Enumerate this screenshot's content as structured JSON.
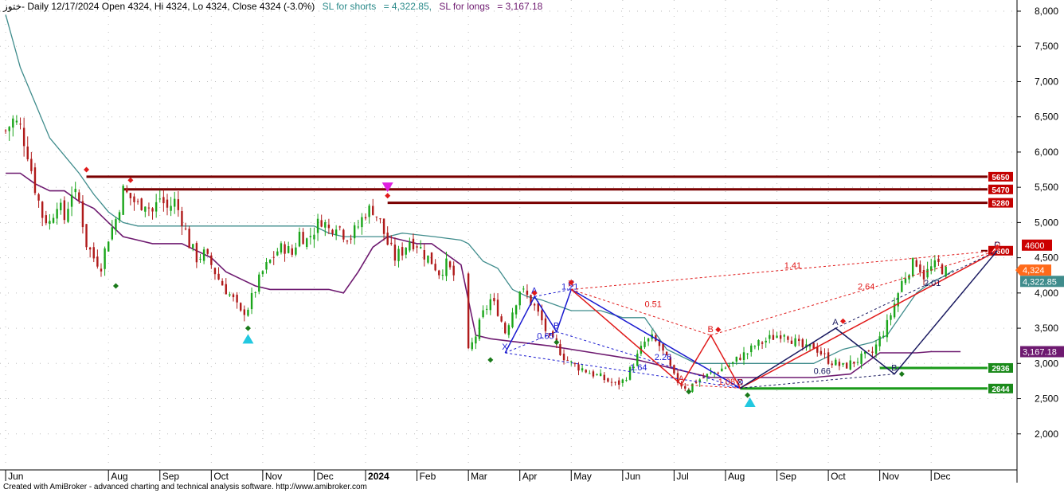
{
  "header": {
    "symbol": "ختوز",
    "title": "- Daily 12/17/2024 Open 4324, Hi 4324, Lo 4324, Close 4324 (-3.0%)",
    "sl_shorts_label": "SL for shorts",
    "sl_shorts_value": "= 4,322.85,",
    "sl_longs_label": "SL for longs",
    "sl_longs_value": "= 3,167.18"
  },
  "footer": "Created with AmiBroker - advanced charting and technical analysis software. http://www.amibroker.com",
  "colors": {
    "resistance": "#7a0000",
    "support": "#1a9a1a",
    "candle_up": "#1aa51a",
    "candle_down": "#b01a1a",
    "stop_shorts": "#3f8c8c",
    "stop_longs": "#6e1a70",
    "harmonic_red": "#e01a1a",
    "harmonic_blue": "#1a1ad0",
    "harmonic_dark": "#1a1a60",
    "marker_cyan": "#22c8e0",
    "marker_magenta": "#e020e0"
  },
  "chart_data": {
    "type": "candlestick",
    "ylim": [
      1600,
      8200
    ],
    "y_ticks": [
      2000,
      2500,
      3000,
      3500,
      4000,
      4500,
      5000,
      5500,
      6000,
      6500,
      7000,
      7500,
      8000
    ],
    "y_tick_labels": [
      "2,000",
      "2,500",
      "3,000",
      "3,500",
      "4,000",
      "4,500",
      "5,000",
      "5,500",
      "6,000",
      "6,500",
      "7,000",
      "7,500",
      "8,000"
    ],
    "x_ticks": [
      {
        "label": "Jun",
        "x": 0,
        "bold": false
      },
      {
        "label": "Aug",
        "x": 42,
        "bold": false
      },
      {
        "label": "Sep",
        "x": 63,
        "bold": false
      },
      {
        "label": "Oct",
        "x": 84,
        "bold": false
      },
      {
        "label": "Nov",
        "x": 105,
        "bold": false
      },
      {
        "label": "Dec",
        "x": 126,
        "bold": false
      },
      {
        "label": "2024",
        "x": 147,
        "bold": true
      },
      {
        "label": "Feb",
        "x": 168,
        "bold": false
      },
      {
        "label": "Mar",
        "x": 189,
        "bold": false
      },
      {
        "label": "Apr",
        "x": 210,
        "bold": false
      },
      {
        "label": "May",
        "x": 231,
        "bold": false
      },
      {
        "label": "Jun",
        "x": 252,
        "bold": false
      },
      {
        "label": "Jul",
        "x": 273,
        "bold": false
      },
      {
        "label": "Aug",
        "x": 294,
        "bold": false
      },
      {
        "label": "Sep",
        "x": 315,
        "bold": false
      },
      {
        "label": "Oct",
        "x": 336,
        "bold": false
      },
      {
        "label": "Nov",
        "x": 357,
        "bold": false
      },
      {
        "label": "Dec",
        "x": 378,
        "bold": false
      }
    ],
    "x_range": [
      -1,
      402
    ],
    "close_path": [
      [
        0,
        6300
      ],
      [
        3,
        6450
      ],
      [
        6,
        6350
      ],
      [
        9,
        6000
      ],
      [
        12,
        5500
      ],
      [
        15,
        5100
      ],
      [
        18,
        5000
      ],
      [
        21,
        5300
      ],
      [
        24,
        5050
      ],
      [
        27,
        5450
      ],
      [
        30,
        5300
      ],
      [
        33,
        4700
      ],
      [
        36,
        4500
      ],
      [
        39,
        4400
      ],
      [
        42,
        4800
      ],
      [
        45,
        5050
      ],
      [
        48,
        5450
      ],
      [
        51,
        5350
      ],
      [
        54,
        5250
      ],
      [
        57,
        5300
      ],
      [
        60,
        5150
      ],
      [
        63,
        5350
      ],
      [
        66,
        5200
      ],
      [
        69,
        5300
      ],
      [
        72,
        5050
      ],
      [
        75,
        4700
      ],
      [
        78,
        4500
      ],
      [
        81,
        4550
      ],
      [
        84,
        4400
      ],
      [
        87,
        4200
      ],
      [
        90,
        4050
      ],
      [
        93,
        3900
      ],
      [
        96,
        3700
      ],
      [
        99,
        3800
      ],
      [
        102,
        4050
      ],
      [
        105,
        4300
      ],
      [
        108,
        4450
      ],
      [
        111,
        4600
      ],
      [
        114,
        4650
      ],
      [
        117,
        4550
      ],
      [
        120,
        4850
      ],
      [
        123,
        4750
      ],
      [
        126,
        4900
      ],
      [
        129,
        5050
      ],
      [
        132,
        4900
      ],
      [
        135,
        5000
      ],
      [
        138,
        4850
      ],
      [
        141,
        4800
      ],
      [
        144,
        4950
      ],
      [
        147,
        5150
      ],
      [
        150,
        5200
      ],
      [
        153,
        5000
      ],
      [
        156,
        4700
      ],
      [
        159,
        4500
      ],
      [
        162,
        4600
      ],
      [
        165,
        4750
      ],
      [
        168,
        4700
      ],
      [
        171,
        4550
      ],
      [
        174,
        4450
      ],
      [
        177,
        4300
      ],
      [
        180,
        4400
      ],
      [
        183,
        4250
      ],
      [
        189,
        3150
      ],
      [
        192,
        3400
      ],
      [
        195,
        3700
      ],
      [
        198,
        3900
      ],
      [
        201,
        3750
      ],
      [
        204,
        3450
      ],
      [
        207,
        3750
      ],
      [
        210,
        4050
      ],
      [
        213,
        3950
      ],
      [
        216,
        3800
      ],
      [
        219,
        3600
      ],
      [
        222,
        3350
      ],
      [
        225,
        3250
      ],
      [
        228,
        3100
      ],
      [
        231,
        3000
      ],
      [
        234,
        2950
      ],
      [
        237,
        2900
      ],
      [
        240,
        2850
      ],
      [
        243,
        2800
      ],
      [
        246,
        2750
      ],
      [
        249,
        2700
      ],
      [
        252,
        2750
      ],
      [
        255,
        2900
      ],
      [
        258,
        3100
      ],
      [
        261,
        3300
      ],
      [
        264,
        3350
      ],
      [
        267,
        3250
      ],
      [
        270,
        3050
      ],
      [
        273,
        2800
      ],
      [
        276,
        2700
      ],
      [
        279,
        2650
      ],
      [
        282,
        2750
      ],
      [
        285,
        2800
      ],
      [
        288,
        2850
      ],
      [
        291,
        2900
      ],
      [
        294,
        2950
      ],
      [
        297,
        3000
      ],
      [
        300,
        3100
      ],
      [
        303,
        3150
      ],
      [
        306,
        3250
      ],
      [
        309,
        3300
      ],
      [
        312,
        3350
      ],
      [
        315,
        3400
      ],
      [
        318,
        3450
      ],
      [
        321,
        3350
      ],
      [
        324,
        3250
      ],
      [
        327,
        3200
      ],
      [
        330,
        3250
      ],
      [
        333,
        3150
      ],
      [
        336,
        3050
      ],
      [
        339,
        3000
      ],
      [
        342,
        2950
      ],
      [
        345,
        3000
      ],
      [
        348,
        3050
      ],
      [
        351,
        3100
      ],
      [
        354,
        3150
      ],
      [
        357,
        3350
      ],
      [
        360,
        3550
      ],
      [
        363,
        3850
      ],
      [
        366,
        4150
      ],
      [
        369,
        4350
      ],
      [
        372,
        4450
      ],
      [
        375,
        4250
      ],
      [
        378,
        4350
      ],
      [
        381,
        4400
      ],
      [
        384,
        4300
      ]
    ],
    "stop_shorts_line": [
      [
        0,
        7950
      ],
      [
        6,
        7200
      ],
      [
        12,
        6700
      ],
      [
        18,
        6200
      ],
      [
        24,
        5950
      ],
      [
        30,
        5700
      ],
      [
        36,
        5400
      ],
      [
        42,
        5150
      ],
      [
        48,
        5000
      ],
      [
        54,
        4950
      ],
      [
        78,
        4950
      ],
      [
        102,
        4950
      ],
      [
        126,
        4950
      ],
      [
        132,
        4850
      ],
      [
        138,
        4800
      ],
      [
        156,
        4800
      ],
      [
        162,
        4850
      ],
      [
        175,
        4800
      ],
      [
        186,
        4750
      ],
      [
        189,
        4700
      ],
      [
        195,
        4450
      ],
      [
        201,
        4350
      ],
      [
        207,
        4050
      ],
      [
        213,
        3950
      ],
      [
        219,
        3900
      ],
      [
        231,
        3750
      ],
      [
        243,
        3750
      ],
      [
        252,
        3650
      ],
      [
        261,
        3650
      ],
      [
        270,
        3200
      ],
      [
        282,
        3000
      ],
      [
        300,
        3000
      ],
      [
        318,
        3000
      ],
      [
        330,
        3000
      ],
      [
        342,
        3200
      ],
      [
        354,
        3300
      ],
      [
        360,
        3400
      ],
      [
        366,
        3700
      ],
      [
        372,
        4000
      ],
      [
        378,
        4150
      ],
      [
        384,
        4250
      ],
      [
        387,
        4322.85
      ]
    ],
    "stop_longs_line": [
      [
        0,
        5700
      ],
      [
        6,
        5700
      ],
      [
        12,
        5550
      ],
      [
        18,
        5450
      ],
      [
        24,
        5450
      ],
      [
        30,
        5300
      ],
      [
        36,
        5200
      ],
      [
        42,
        5000
      ],
      [
        48,
        4800
      ],
      [
        54,
        4750
      ],
      [
        60,
        4700
      ],
      [
        72,
        4700
      ],
      [
        84,
        4500
      ],
      [
        90,
        4300
      ],
      [
        96,
        4200
      ],
      [
        102,
        4100
      ],
      [
        108,
        4050
      ],
      [
        126,
        4050
      ],
      [
        132,
        4050
      ],
      [
        138,
        4000
      ],
      [
        144,
        4300
      ],
      [
        150,
        4650
      ],
      [
        156,
        4800
      ],
      [
        162,
        4750
      ],
      [
        168,
        4700
      ],
      [
        174,
        4700
      ],
      [
        180,
        4550
      ],
      [
        186,
        4400
      ],
      [
        189,
        3900
      ],
      [
        192,
        3400
      ],
      [
        198,
        3350
      ],
      [
        210,
        3300
      ],
      [
        222,
        3250
      ],
      [
        240,
        3150
      ],
      [
        258,
        3050
      ],
      [
        276,
        2900
      ],
      [
        288,
        2800
      ],
      [
        300,
        2800
      ],
      [
        318,
        2800
      ],
      [
        330,
        2800
      ],
      [
        345,
        2850
      ],
      [
        357,
        3150
      ],
      [
        372,
        3150
      ],
      [
        378,
        3167.18
      ],
      [
        390,
        3167.18
      ]
    ],
    "resistance_lines": [
      {
        "value": 5650,
        "label": "5650",
        "x_start": 33
      },
      {
        "value": 5470,
        "label": "5470",
        "x_start": 48
      },
      {
        "value": 5280,
        "label": "5280",
        "x_start": 156
      }
    ],
    "support_lines": [
      {
        "value": 2936,
        "label": "2936",
        "x_start": 357
      },
      {
        "value": 2644,
        "label": "2644",
        "x_start": 300
      }
    ],
    "price_badges": [
      {
        "label": "4600",
        "value": 4600,
        "color": "#cc0000",
        "text_color": "#ffffff"
      },
      {
        "label": "4,324",
        "value": 4324,
        "color": "#ff6a1a",
        "text_color": "#ffffff"
      },
      {
        "label": "4,322.85",
        "value": 4322.85,
        "color": "#3f8c8c",
        "text_color": "#ffffff"
      },
      {
        "label": "3,167.18",
        "value": 3167.18,
        "color": "#6e1a70",
        "text_color": "#ffffff"
      }
    ],
    "resistance_labels": [
      {
        "label": "5650",
        "value": 5650
      },
      {
        "label": "5470",
        "value": 5470
      },
      {
        "label": "5280",
        "value": 5280
      },
      {
        "label": "4600",
        "value": 4600
      },
      {
        "label": "2936",
        "value": 2936
      },
      {
        "label": "2644",
        "value": 2644
      }
    ],
    "pattern_blue": {
      "points": [
        {
          "label": "X",
          "x": 204,
          "y": 3150
        },
        {
          "label": "A",
          "x": 216,
          "y": 3950
        },
        {
          "label": "B",
          "x": 225,
          "y": 3450
        },
        {
          "label": "C",
          "x": 231,
          "y": 4050
        },
        {
          "label": "D",
          "x": 300,
          "y": 2650
        }
      ],
      "ratios": [
        {
          "label": "0.65",
          "x": 217,
          "y": 3350
        },
        {
          "label": "1.21",
          "x": 227,
          "y": 4050
        },
        {
          "label": "1.64",
          "x": 255,
          "y": 2900
        },
        {
          "label": "2.26",
          "x": 265,
          "y": 3050
        }
      ]
    },
    "pattern_red": {
      "points": [
        {
          "label": "X",
          "x": 231,
          "y": 4050
        },
        {
          "label": "A",
          "x": 276,
          "y": 2700
        },
        {
          "label": "B",
          "x": 288,
          "y": 3400
        },
        {
          "label": "C",
          "x": 300,
          "y": 2650
        },
        {
          "label": "D",
          "x": 405,
          "y": 4600
        }
      ],
      "ratios": [
        {
          "label": "0.51",
          "x": 261,
          "y": 3800
        },
        {
          "label": "1.08",
          "x": 291,
          "y": 2700
        },
        {
          "label": "1.41",
          "x": 318,
          "y": 4350
        },
        {
          "label": "2.64",
          "x": 348,
          "y": 4050
        }
      ]
    },
    "pattern_dark": {
      "points": [
        {
          "label": "X",
          "x": 300,
          "y": 2650
        },
        {
          "label": "A",
          "x": 339,
          "y": 3500
        },
        {
          "label": "B",
          "x": 363,
          "y": 2850
        },
        {
          "label": "C",
          "x": 405,
          "y": 4600
        }
      ],
      "ratios": [
        {
          "label": "0.66",
          "x": 330,
          "y": 2850
        },
        {
          "label": "2.01",
          "x": 375,
          "y": 4100
        }
      ]
    },
    "diamond_markers": [
      {
        "x": 33,
        "y": 5750,
        "color": "#e01a1a"
      },
      {
        "x": 51,
        "y": 5600,
        "color": "#e01a1a"
      },
      {
        "x": 45,
        "y": 4100,
        "color": "#1a7a1a"
      },
      {
        "x": 99,
        "y": 3500,
        "color": "#1a7a1a"
      },
      {
        "x": 156,
        "y": 5380,
        "color": "#e01a1a"
      },
      {
        "x": 198,
        "y": 3050,
        "color": "#1a7a1a"
      },
      {
        "x": 216,
        "y": 4000,
        "color": "#e01a1a"
      },
      {
        "x": 231,
        "y": 4150,
        "color": "#e01a1a"
      },
      {
        "x": 225,
        "y": 3300,
        "color": "#1a7a1a"
      },
      {
        "x": 279,
        "y": 2600,
        "color": "#1a7a1a"
      },
      {
        "x": 291,
        "y": 3480,
        "color": "#e01a1a"
      },
      {
        "x": 303,
        "y": 2550,
        "color": "#1a7a1a"
      },
      {
        "x": 342,
        "y": 3600,
        "color": "#e01a1a"
      },
      {
        "x": 366,
        "y": 2850,
        "color": "#1a7a1a"
      },
      {
        "x": 405,
        "y": 4650,
        "color": "#e01a1a"
      }
    ],
    "arrow_markers": [
      {
        "x": 99,
        "y": 3350,
        "dir": "up",
        "color": "#22c8e0"
      },
      {
        "x": 304,
        "y": 2450,
        "dir": "up",
        "color": "#22c8e0"
      },
      {
        "x": 156,
        "y": 5500,
        "dir": "down",
        "color": "#e020e0"
      }
    ]
  }
}
